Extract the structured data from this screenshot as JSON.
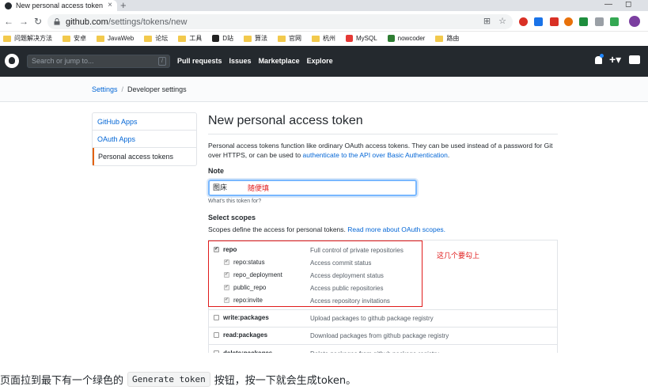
{
  "browser": {
    "tab_title": "New personal access token",
    "tab_close": "×",
    "new_tab": "+",
    "win_min": "—",
    "win_max": "◻",
    "url_host": "github.com",
    "url_path": "/settings/tokens/new",
    "bookmarks": [
      {
        "label": "问题解决方法",
        "type": "folder"
      },
      {
        "label": "安卓",
        "type": "folder"
      },
      {
        "label": "JavaWeb",
        "type": "folder"
      },
      {
        "label": "论坛",
        "type": "folder"
      },
      {
        "label": "工具",
        "type": "folder"
      },
      {
        "label": "D站",
        "type": "site"
      },
      {
        "label": "算法",
        "type": "folder"
      },
      {
        "label": "官网",
        "type": "folder"
      },
      {
        "label": "杭州",
        "type": "folder"
      },
      {
        "label": "MySQL",
        "type": "site"
      },
      {
        "label": "nowcoder",
        "type": "site"
      },
      {
        "label": "路由",
        "type": "folder"
      }
    ]
  },
  "header": {
    "search_placeholder": "Search or jump to...",
    "search_shortcut": "/",
    "nav": [
      "Pull requests",
      "Issues",
      "Marketplace",
      "Explore"
    ]
  },
  "breadcrumb": {
    "settings": "Settings",
    "separator": "/",
    "current": "Developer settings"
  },
  "sidemenu": {
    "items": [
      "GitHub Apps",
      "OAuth Apps",
      "Personal access tokens"
    ]
  },
  "main": {
    "title": "New personal access token",
    "desc_text": "Personal access tokens function like ordinary OAuth access tokens. They can be used instead of a password for Git over HTTPS, or can be used to ",
    "desc_link": "authenticate to the API over Basic Authentication",
    "desc_end": ".",
    "note_label": "Note",
    "note_value": "图床",
    "note_annotation": "随便填",
    "note_hint": "What's this token for?",
    "scopes_title": "Select scopes",
    "scopes_note": "Scopes define the access for personal tokens. ",
    "scopes_link": "Read more about OAuth scopes.",
    "scopes_annotation": "这几个要勾上"
  },
  "scopes": [
    {
      "name": "repo",
      "desc": "Full control of private repositories",
      "checked": true,
      "sub": false
    },
    {
      "name": "repo:status",
      "desc": "Access commit status",
      "checked": true,
      "sub": true
    },
    {
      "name": "repo_deployment",
      "desc": "Access deployment status",
      "checked": true,
      "sub": true
    },
    {
      "name": "public_repo",
      "desc": "Access public repositories",
      "checked": true,
      "sub": true
    },
    {
      "name": "repo:invite",
      "desc": "Access repository invitations",
      "checked": true,
      "sub": true
    },
    {
      "name": "write:packages",
      "desc": "Upload packages to github package registry",
      "checked": false,
      "sub": false
    },
    {
      "name": "read:packages",
      "desc": "Download packages from github package registry",
      "checked": false,
      "sub": false
    },
    {
      "name": "delete:packages",
      "desc": "Delete packages from github package registry",
      "checked": false,
      "sub": false
    }
  ],
  "footer": {
    "text_before": "页面拉到最下有一个绿色的",
    "code": "Generate token",
    "text_after": "按钮，按一下就会生成token。"
  }
}
